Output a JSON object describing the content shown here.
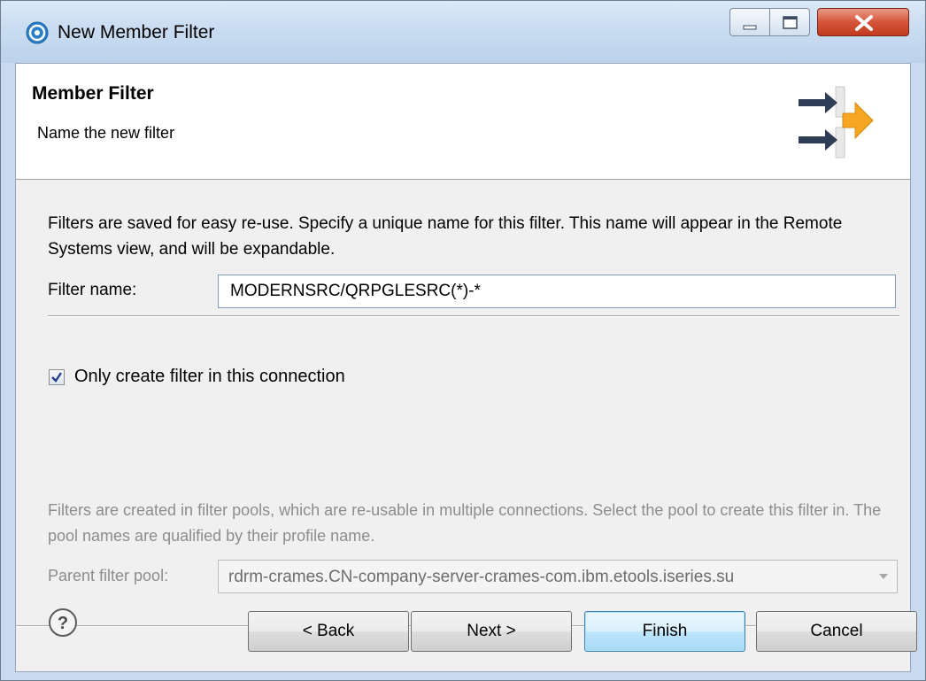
{
  "window": {
    "title": "New Member Filter"
  },
  "header": {
    "title": "Member Filter",
    "subtitle": "Name the new filter"
  },
  "filter": {
    "description": "Filters are saved for easy re-use. Specify a unique name for this filter. This name will appear in the Remote Systems view, and will be expandable.",
    "name_label": "Filter name:",
    "name_value": "MODERNSRC/QRPGLESRC(*)-*"
  },
  "connection_option": {
    "label": "Only create filter in this connection",
    "checked": true
  },
  "pool": {
    "description": "Filters are created in filter pools, which are re-usable in multiple connections. Select the pool to create this filter in. The pool names are qualified by their profile name.",
    "label": "Parent filter pool:",
    "selected": "rdrm-crames.CN-company-server-crames-com.ibm.etools.iseries.su",
    "disabled": true
  },
  "buttons": {
    "back": "< Back",
    "next": "Next >",
    "finish": "Finish",
    "cancel": "Cancel"
  },
  "icons": {
    "app": "app-circle-icon",
    "wizard": "filter-wizard-arrows-icon",
    "help": "help-icon"
  },
  "colors": {
    "accent_orange": "#f5a623",
    "arrow_navy": "#2f3e56",
    "close_red": "#c8462c"
  }
}
